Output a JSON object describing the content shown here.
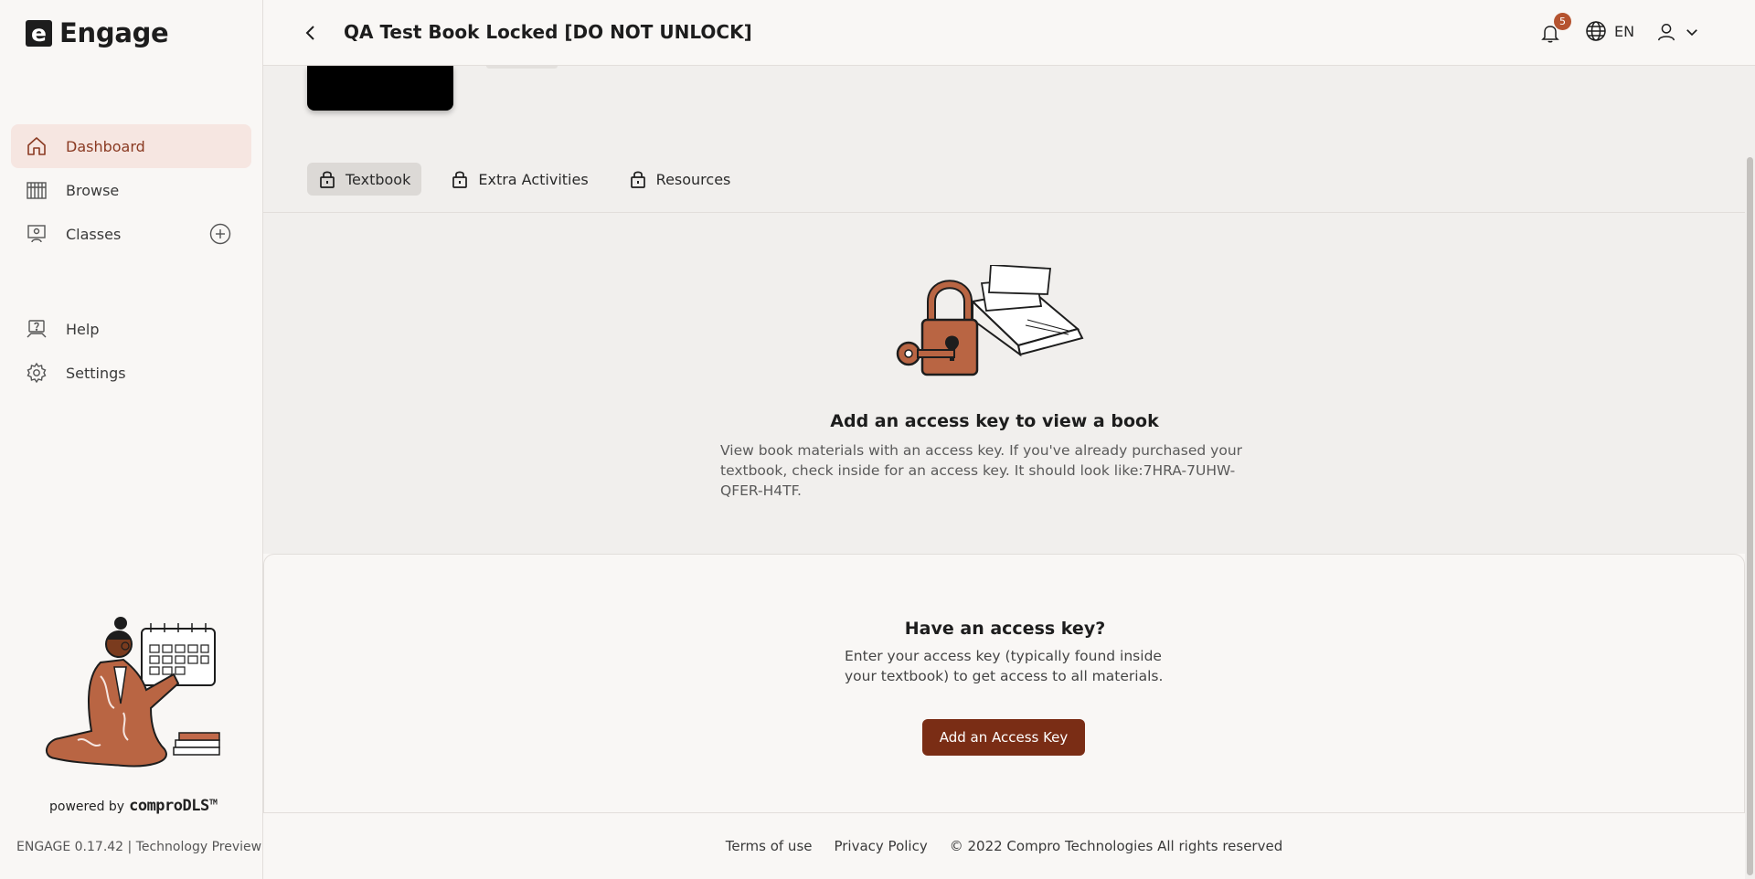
{
  "app": {
    "name": "Engage",
    "logo_letter": "e"
  },
  "sidebar": {
    "items": [
      {
        "label": "Dashboard",
        "icon": "home-icon",
        "active": true
      },
      {
        "label": "Browse",
        "icon": "library-icon",
        "active": false
      },
      {
        "label": "Classes",
        "icon": "classroom-icon",
        "active": false
      }
    ],
    "secondary_items": [
      {
        "label": "Help",
        "icon": "help-icon"
      },
      {
        "label": "Settings",
        "icon": "gear-icon"
      }
    ],
    "powered_by_label": "powered by",
    "powered_by_brand": "comproDLS",
    "powered_by_tm": "TM",
    "version": "ENGAGE 0.17.42 | Technology Preview"
  },
  "header": {
    "title": "QA Test Book Locked [DO NOT UNLOCK]",
    "notification_count": "5",
    "language": "EN"
  },
  "tabs": [
    {
      "label": "Textbook",
      "active": true
    },
    {
      "label": "Extra Activities",
      "active": false
    },
    {
      "label": "Resources",
      "active": false
    }
  ],
  "locked": {
    "title": "Add an access key to view a book",
    "description": "View book materials with an access key. If you've already purchased your textbook, check inside for an access key. It should look like:7HRA-7UHW-QFER-H4TF."
  },
  "access_key_card": {
    "title": "Have an access key?",
    "description": "Enter your access key (typically found inside your textbook) to get access to all materials.",
    "button_label": "Add an Access Key"
  },
  "footer": {
    "terms": "Terms of use",
    "privacy": "Privacy Policy",
    "copyright": "© 2022 Compro Technologies All rights reserved"
  },
  "colors": {
    "accent": "#7a2d15",
    "active_bg": "#f6e6e1",
    "badge": "#b5532f"
  }
}
